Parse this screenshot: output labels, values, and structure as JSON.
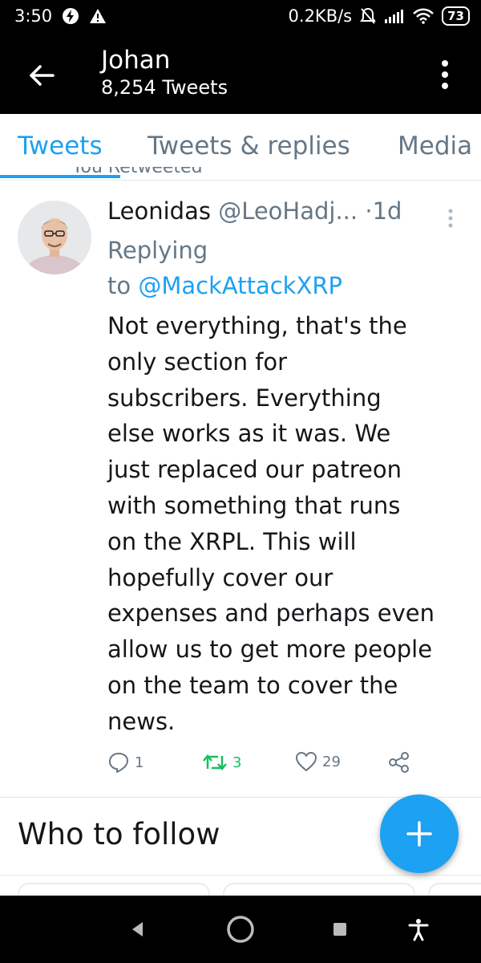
{
  "status_bar": {
    "time": "3:50",
    "network_speed": "0.2KB/s",
    "battery": "73"
  },
  "header": {
    "title": "Johan",
    "subtitle": "8,254 Tweets"
  },
  "tabs": [
    {
      "label": "Tweets",
      "active": true
    },
    {
      "label": "Tweets & replies",
      "active": false
    },
    {
      "label": "Media",
      "active": false
    }
  ],
  "tweet": {
    "retweet_label": "You Retweeted",
    "author_name": "Leonidas",
    "author_handle": "@LeoHadj...",
    "time_sep": "·",
    "time": "1d",
    "replying_prefix": "Replying",
    "replying_to": "to",
    "mention": "@MackAttackXRP",
    "text": "Not everything, that's the\nonly section for\nsubscribers. Everything\nelse works as it was. We\njust replaced our patreon\nwith something that runs\non the XRPL. This will\nhopefully cover our\nexpenses and perhaps even\nallow us to get more people\non the team to cover the\nnews.",
    "reply_count": "1",
    "retweet_count": "3",
    "like_count": "29"
  },
  "who_to_follow": {
    "title": "Who to follow"
  },
  "colors": {
    "accent": "#1da1f2",
    "retweet_green": "#17bf63",
    "muted": "#657786"
  }
}
